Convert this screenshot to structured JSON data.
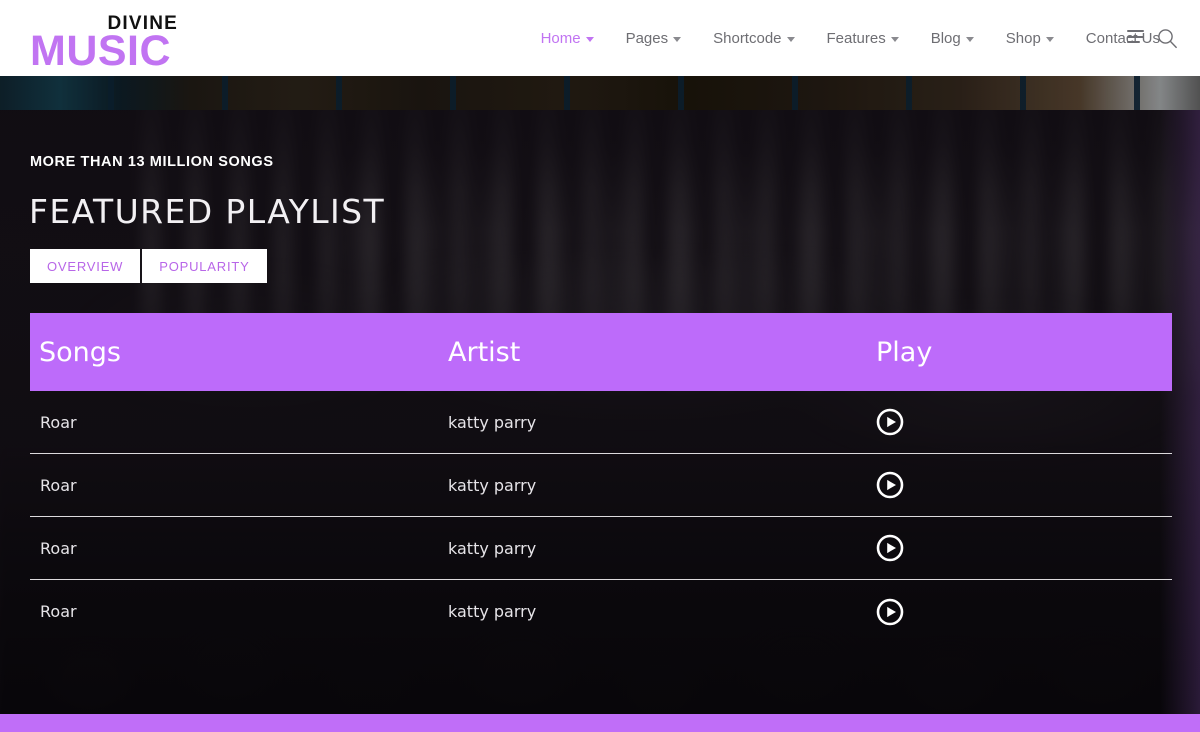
{
  "brand": {
    "line1": "DIVINE",
    "line2": "MUSIC",
    "accent_color": "#c174f2"
  },
  "nav": {
    "items": [
      {
        "label": "Home",
        "has_caret": true,
        "active": true
      },
      {
        "label": "Pages",
        "has_caret": true,
        "active": false
      },
      {
        "label": "Shortcode",
        "has_caret": true,
        "active": false
      },
      {
        "label": "Features",
        "has_caret": true,
        "active": false
      },
      {
        "label": "Blog",
        "has_caret": true,
        "active": false
      },
      {
        "label": "Shop",
        "has_caret": true,
        "active": false
      },
      {
        "label": "Contact Us",
        "has_caret": false,
        "active": false
      }
    ],
    "menu_icon": "hamburger-icon",
    "search_icon": "search-icon"
  },
  "hero": {
    "eyebrow": "MORE THAN 13 MILLION SONGS",
    "title": "FEATURED PLAYLIST",
    "tabs": [
      {
        "label": "OVERVIEW",
        "active": true
      },
      {
        "label": "POPULARITY",
        "active": false
      }
    ],
    "tab_text_color": "#b866e8",
    "tab_bg_color": "#ffffff"
  },
  "playlist_table": {
    "header_bg": "#bd6bfa",
    "columns": [
      "Songs",
      "Artist",
      "Play"
    ],
    "rows": [
      {
        "song": "Roar",
        "artist": "katty parry",
        "play_icon": "play-circle-icon"
      },
      {
        "song": "Roar",
        "artist": "katty parry",
        "play_icon": "play-circle-icon"
      },
      {
        "song": "Roar",
        "artist": "katty parry",
        "play_icon": "play-circle-icon"
      },
      {
        "song": "Roar",
        "artist": "katty parry",
        "play_icon": "play-circle-icon"
      }
    ]
  },
  "footer": {
    "bar_color": "#c06ef8"
  }
}
